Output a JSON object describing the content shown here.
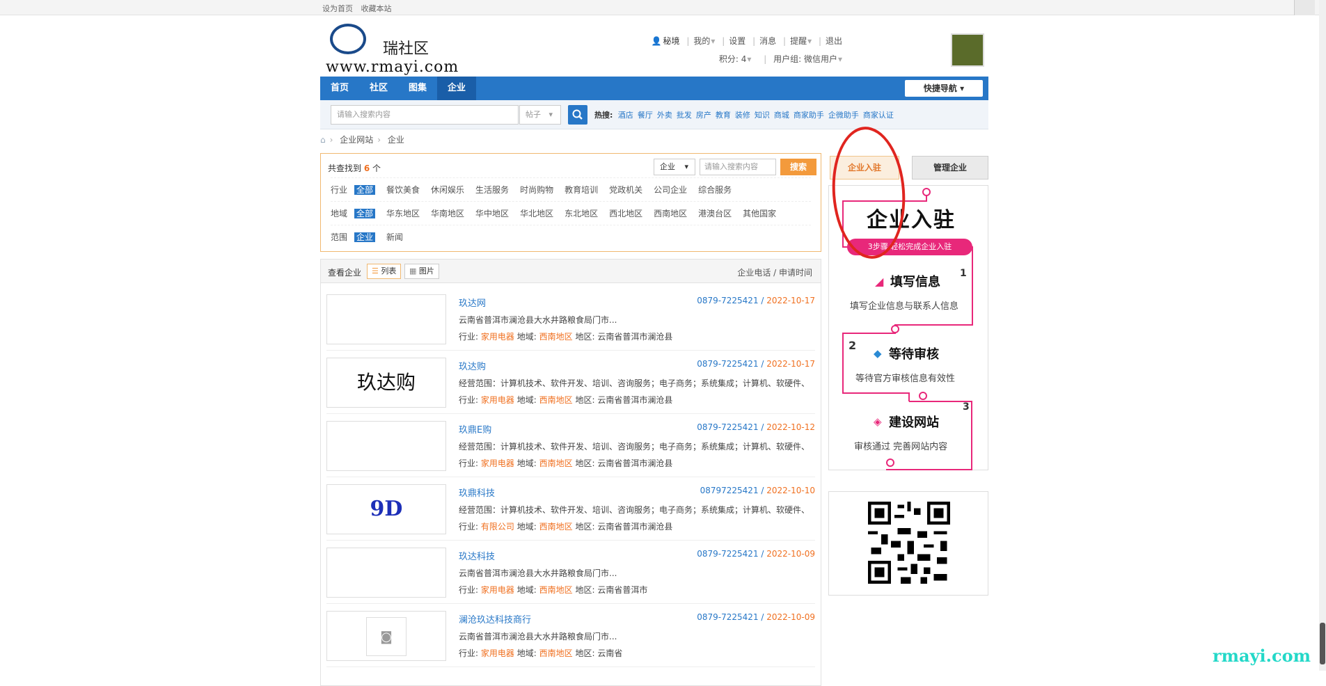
{
  "topbar": {
    "set_home": "设为首页",
    "bookmark": "收藏本站"
  },
  "logo": {
    "name": "瑞社区",
    "url": "www.rmayi.com"
  },
  "user": {
    "name": "秘境",
    "my": "我的",
    "settings": "设置",
    "messages": "消息",
    "remind": "提醒",
    "logout": "退出",
    "points": "积分: 4",
    "group": "用户组: 微信用户"
  },
  "nav": {
    "items": [
      "首页",
      "社区",
      "图集",
      "企业"
    ],
    "active": "企业",
    "quick": "快捷导航"
  },
  "search": {
    "placeholder": "请输入搜索内容",
    "type": "帖子",
    "hot_label": "热搜:",
    "hot": [
      "酒店",
      "餐厅",
      "外卖",
      "批发",
      "房产",
      "教育",
      "装修",
      "知识",
      "商城",
      "商家助手",
      "企微助手",
      "商家认证"
    ]
  },
  "breadcrumb": [
    "企业网站",
    "企业"
  ],
  "filter": {
    "count_prefix": "共查找到",
    "count": "6",
    "count_suffix": "个",
    "select": "企业",
    "placeholder": "请输入搜索内容",
    "button": "搜索",
    "rows": [
      {
        "label": "行业",
        "options": [
          "全部",
          "餐饮美食",
          "休闲娱乐",
          "生活服务",
          "时尚购物",
          "教育培训",
          "党政机关",
          "公司企业",
          "综合服务"
        ]
      },
      {
        "label": "地域",
        "options": [
          "全部",
          "华东地区",
          "华南地区",
          "华中地区",
          "华北地区",
          "东北地区",
          "西北地区",
          "西南地区",
          "港澳台区",
          "其他国家"
        ]
      },
      {
        "label": "范围",
        "options": [
          "企业",
          "新闻"
        ]
      }
    ]
  },
  "list": {
    "view_label": "查看企业",
    "list_btn": "列表",
    "image_btn": "图片",
    "sort": "企业电话 / 申请时间",
    "items": [
      {
        "name": "玖达网",
        "phone": "0879-7225421",
        "date": "2022-10-17",
        "desc": "云南省普洱市澜沧县大水井路粮食局门市...",
        "industry": "家用电器",
        "region": "西南地区",
        "area": "云南省普洱市澜沧县",
        "thumb": ""
      },
      {
        "name": "玖达购",
        "phone": "0879-7225421",
        "date": "2022-10-17",
        "desc": "经营范围：计算机技术、软件开发、培训、咨询服务；电子商务；系统集成；计算机、软硬件、",
        "industry": "家用电器",
        "region": "西南地区",
        "area": "云南省普洱市澜沧县",
        "thumb": "玖达购"
      },
      {
        "name": "玖鼎E购",
        "phone": "0879-7225421",
        "date": "2022-10-12",
        "desc": "经营范围：计算机技术、软件开发、培训、咨询服务；电子商务；系统集成；计算机、软硬件、",
        "industry": "家用电器",
        "region": "西南地区",
        "area": "云南省普洱市澜沧县",
        "thumb": ""
      },
      {
        "name": "玖鼎科技",
        "phone": "08797225421",
        "date": "2022-10-10",
        "desc": "经营范围：计算机技术、软件开发、培训、咨询服务；电子商务；系统集成；计算机、软硬件、",
        "industry": "有限公司",
        "region": "西南地区",
        "area": "云南省普洱市澜沧县",
        "thumb": "9D"
      },
      {
        "name": "玖达科技",
        "phone": "0879-7225421",
        "date": "2022-10-09",
        "desc": "云南省普洱市澜沧县大水井路粮食局门市...",
        "industry": "家用电器",
        "region": "西南地区",
        "area": "云南省普洱市",
        "thumb": ""
      },
      {
        "name": "澜沧玖达科技商行",
        "phone": "0879-7225421",
        "date": "2022-10-09",
        "desc": "云南省普洱市澜沧县大水井路粮食局门市...",
        "industry": "家用电器",
        "region": "西南地区",
        "area": "云南省",
        "thumb": "camera"
      }
    ],
    "labels": {
      "industry": "行业:",
      "region": "地域:",
      "area": "地区:"
    }
  },
  "side": {
    "tab_join": "企业入驻",
    "tab_manage": "管理企业",
    "banner_title": "企业入驻",
    "banner_pill": "3步骤  轻松完成企业入驻",
    "steps": [
      {
        "num": "1",
        "title": "填写信息",
        "sub": "填写企业信息与联系人信息"
      },
      {
        "num": "2",
        "title": "等待审核",
        "sub": "等待官方审核信息有效性"
      },
      {
        "num": "3",
        "title": "建设网站",
        "sub": "审核通过  完善网站内容"
      }
    ]
  },
  "watermark": "rmayi.com",
  "colors": {
    "accent": "#2777c7",
    "orange": "#f07020",
    "pink": "#e8287a",
    "annotation": "#e0251f"
  }
}
